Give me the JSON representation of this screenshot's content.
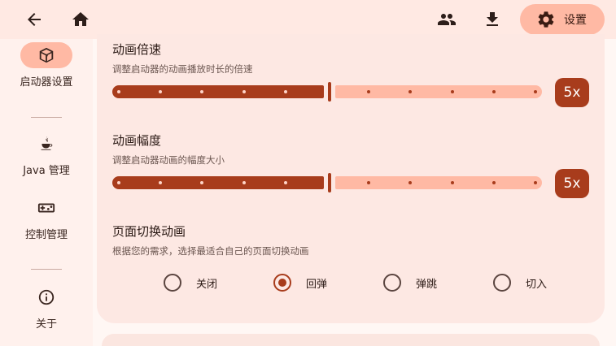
{
  "topbar": {
    "back_icon": "arrow-back-icon",
    "home_icon": "home-icon",
    "accounts_icon": "people-icon",
    "download_icon": "download-icon",
    "settings_label": "设置"
  },
  "sidebar": {
    "items": [
      {
        "label": "启动器设置",
        "icon": "cube-icon",
        "active": true
      },
      {
        "label": "Java 管理",
        "icon": "java-icon",
        "active": false
      },
      {
        "label": "控制管理",
        "icon": "gamepad-icon",
        "active": false
      },
      {
        "label": "关于",
        "icon": "info-icon",
        "active": false
      }
    ]
  },
  "settings": {
    "anim_speed": {
      "title": "动画倍速",
      "desc": "调整启动器的动画播放时长的倍速",
      "value_label": "5x",
      "value": 5,
      "min": 0,
      "max": 10
    },
    "anim_amplitude": {
      "title": "动画幅度",
      "desc": "调整启动器动画的幅度大小",
      "value_label": "5x",
      "value": 5,
      "min": 0,
      "max": 10
    },
    "page_transition": {
      "title": "页面切换动画",
      "desc": "根据您的需求，选择最适合自己的页面切换动画",
      "options": [
        "关闭",
        "回弹",
        "弹跳",
        "切入"
      ],
      "selected": 1
    }
  },
  "colors": {
    "accent": "#a83c1c",
    "accent_light": "#ffb9a4",
    "card_bg": "#fde8e3"
  }
}
